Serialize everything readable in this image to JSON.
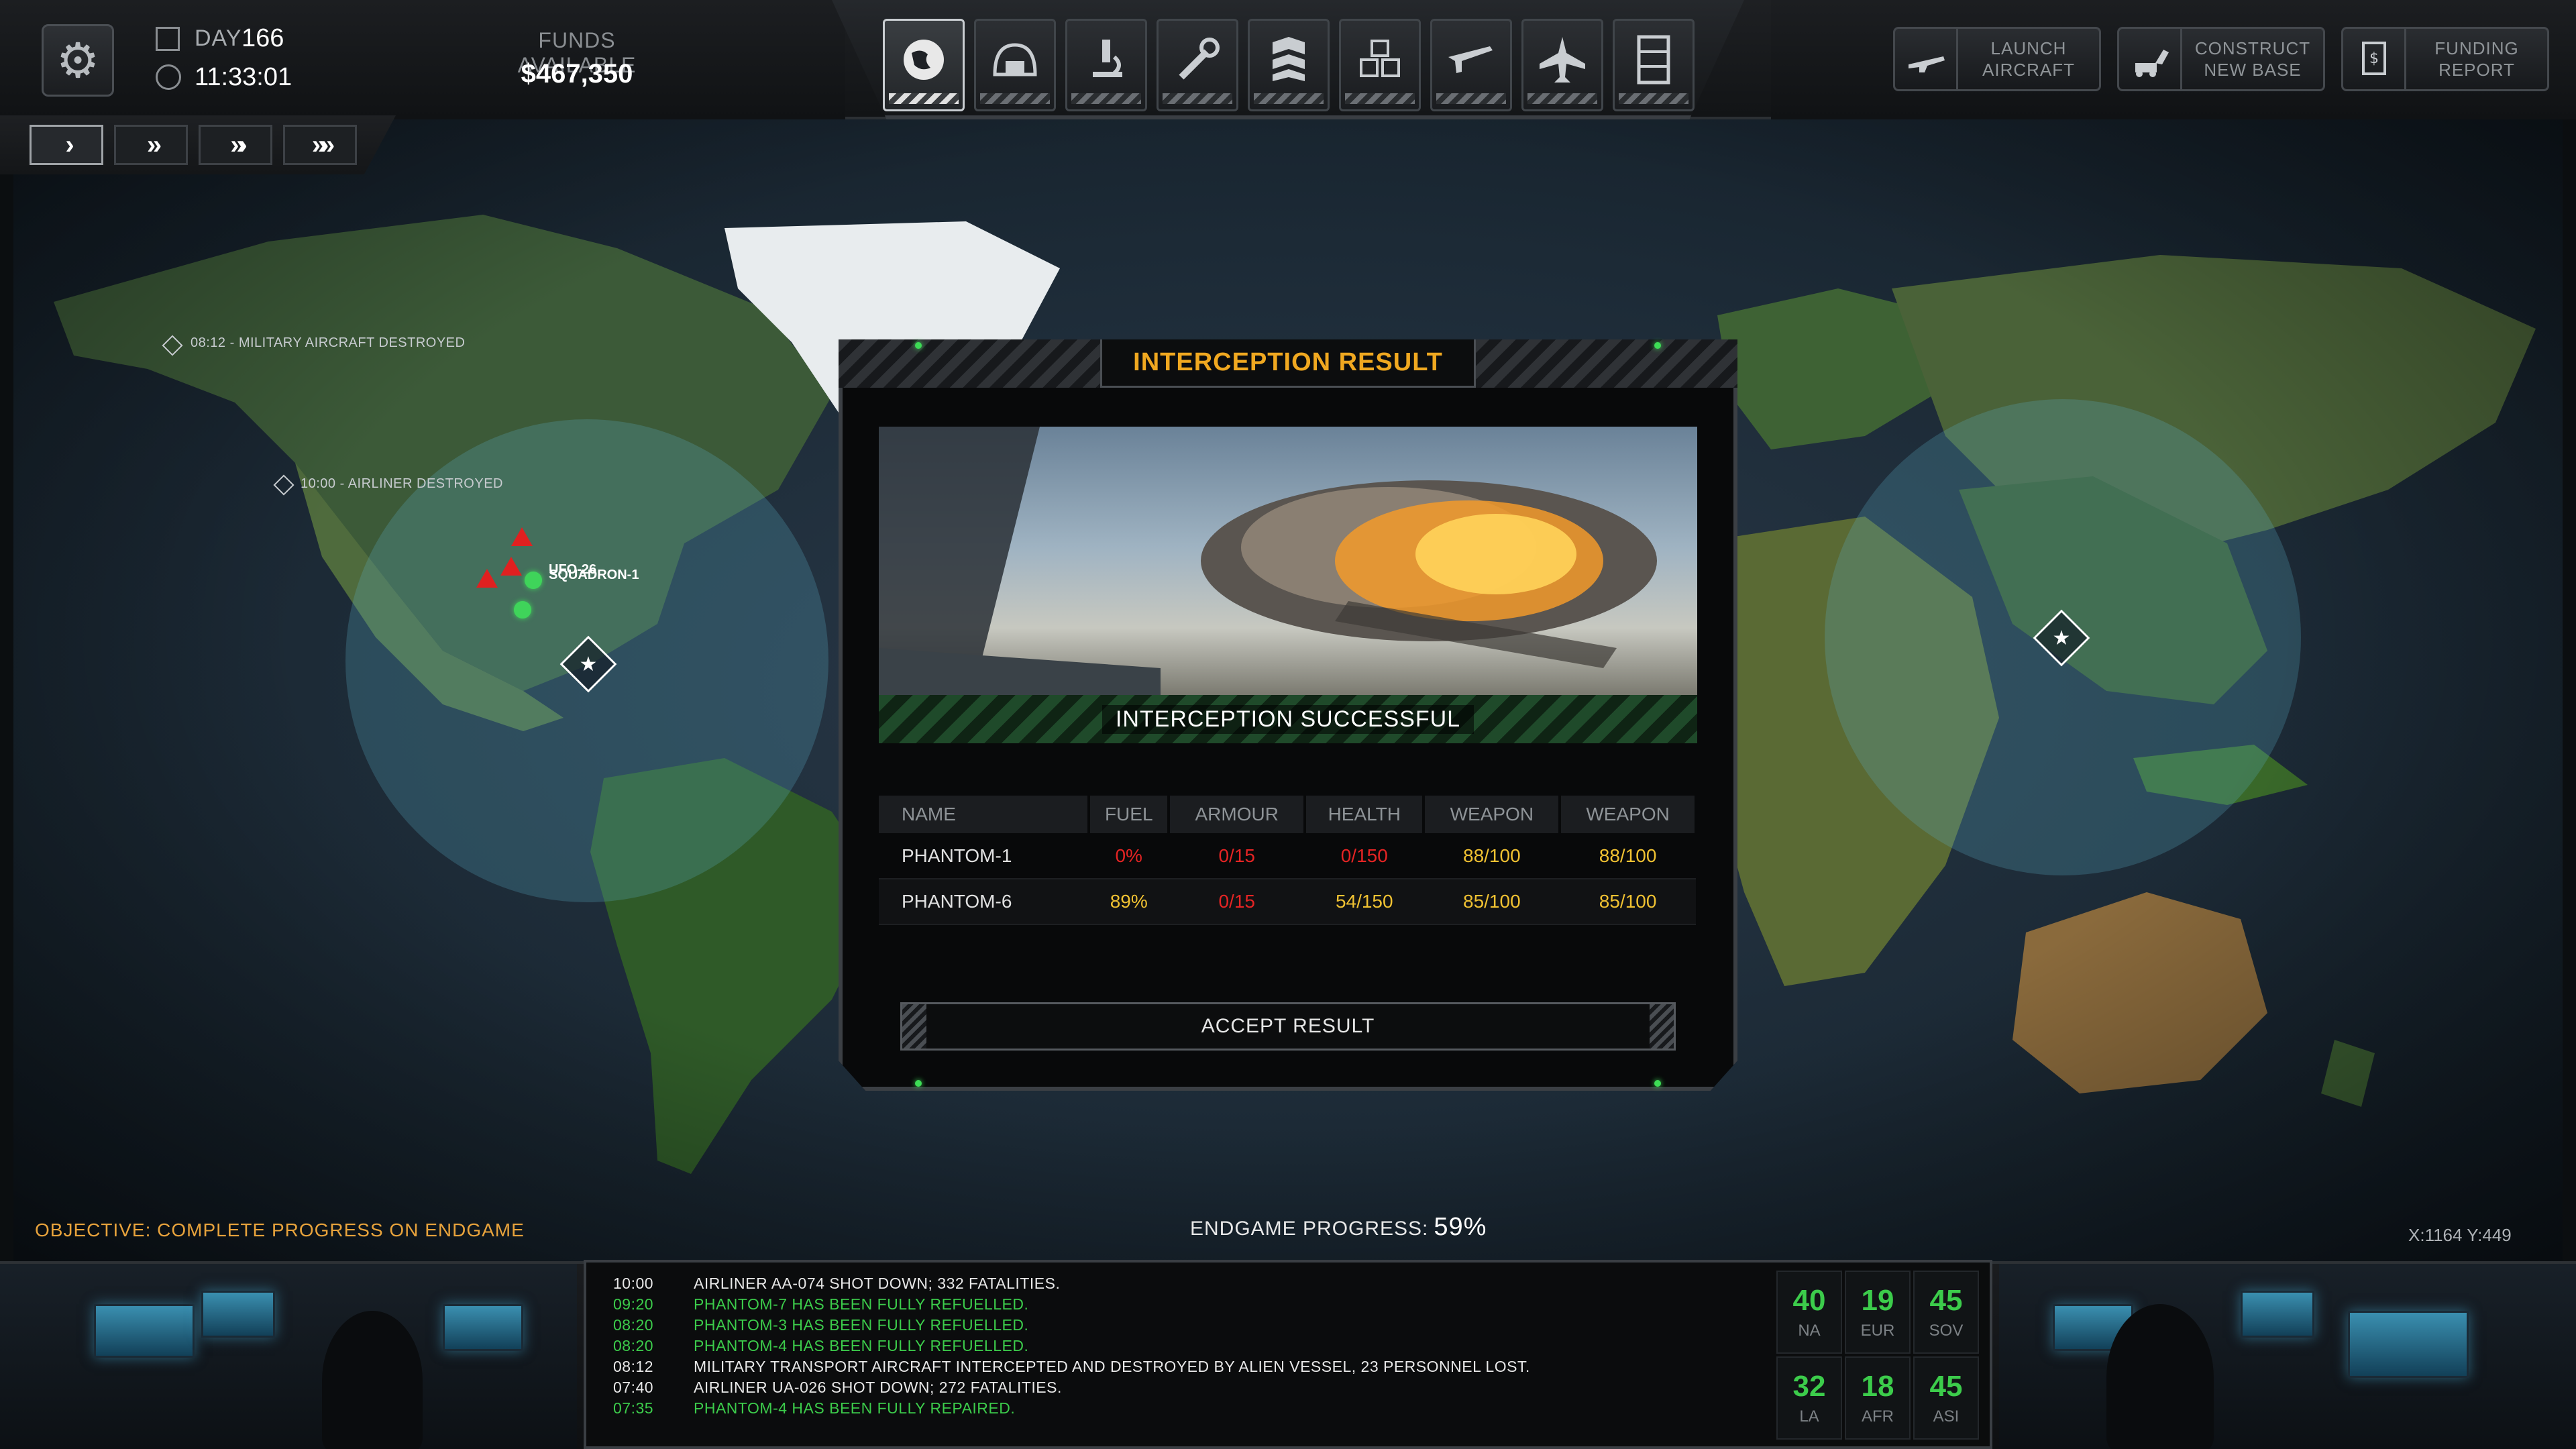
{
  "header": {
    "day_label": "DAY",
    "day_value": "166",
    "time": "11:33:01",
    "funds_label": "FUNDS AVAILABLE",
    "funds_value": "$467,350"
  },
  "nav": [
    {
      "name": "geoscape",
      "icon": "globe-icon",
      "active": true
    },
    {
      "name": "base",
      "icon": "hangar-dome-icon",
      "active": false
    },
    {
      "name": "research",
      "icon": "microscope-icon",
      "active": false
    },
    {
      "name": "engineering",
      "icon": "wrench-icon",
      "active": false
    },
    {
      "name": "soldiers",
      "icon": "rank-chevron-icon",
      "active": false
    },
    {
      "name": "stores",
      "icon": "crates-icon",
      "active": false
    },
    {
      "name": "armory",
      "icon": "rifle-icon",
      "active": false
    },
    {
      "name": "hangar",
      "icon": "jet-icon",
      "active": false
    },
    {
      "name": "archive",
      "icon": "cabinet-icon",
      "active": false
    }
  ],
  "actions": [
    {
      "id": "launch",
      "label": "LAUNCH\nAIRCRAFT",
      "icon": "aircraft-icon"
    },
    {
      "id": "construct",
      "label": "CONSTRUCT\nNEW BASE",
      "icon": "excavator-icon"
    },
    {
      "id": "funding",
      "label": "FUNDING\nREPORT",
      "icon": "report-icon"
    }
  ],
  "speed": {
    "active_index": 0
  },
  "map": {
    "event_labels": [
      "08:12 - MILITARY AIRCRAFT DESTROYED",
      "10:00 - AIRLINER DESTROYED"
    ],
    "ufo_label": "UFO-26",
    "squadron_label": "SQUADRON-1"
  },
  "dialog": {
    "title": "INTERCEPTION RESULT",
    "status": "INTERCEPTION SUCCESSFUL",
    "columns": [
      "NAME",
      "FUEL",
      "ARMOUR",
      "HEALTH",
      "WEAPON",
      "WEAPON"
    ],
    "rows": [
      {
        "name": "PHANTOM-1",
        "fuel": "0%",
        "armour": "0/15",
        "health": "0/150",
        "weapon1": "88/100",
        "weapon2": "88/100",
        "colors": {
          "fuel": "#e52424",
          "armour": "#e52424",
          "health": "#e52424",
          "weapon1": "#f1c232",
          "weapon2": "#f1c232"
        }
      },
      {
        "name": "PHANTOM-6",
        "fuel": "89%",
        "armour": "0/15",
        "health": "54/150",
        "weapon1": "85/100",
        "weapon2": "85/100",
        "colors": {
          "fuel": "#f1c232",
          "armour": "#e52424",
          "health": "#f1c232",
          "weapon1": "#f1c232",
          "weapon2": "#f1c232"
        }
      }
    ],
    "accept_label": "ACCEPT RESULT"
  },
  "objective": "OBJECTIVE: COMPLETE PROGRESS ON ENDGAME",
  "endgame": {
    "label": "ENDGAME PROGRESS:",
    "value": "59%"
  },
  "coords": "X:1164  Y:449",
  "log": [
    {
      "time": "10:00",
      "text": "AIRLINER AA-074 SHOT DOWN; 332 FATALITIES.",
      "color": "white"
    },
    {
      "time": "09:20",
      "text": "PHANTOM-7 HAS BEEN FULLY REFUELLED.",
      "color": "green"
    },
    {
      "time": "08:20",
      "text": "PHANTOM-3 HAS BEEN FULLY REFUELLED.",
      "color": "green"
    },
    {
      "time": "08:20",
      "text": "PHANTOM-4 HAS BEEN FULLY REFUELLED.",
      "color": "green"
    },
    {
      "time": "08:12",
      "text": "MILITARY TRANSPORT AIRCRAFT INTERCEPTED AND DESTROYED BY ALIEN VESSEL, 23 PERSONNEL LOST.",
      "color": "white"
    },
    {
      "time": "07:40",
      "text": "AIRLINER UA-026 SHOT DOWN; 272 FATALITIES.",
      "color": "white"
    },
    {
      "time": "07:35",
      "text": "PHANTOM-4 HAS BEEN FULLY REPAIRED.",
      "color": "green"
    }
  ],
  "regions": [
    {
      "code": "NA",
      "value": "40"
    },
    {
      "code": "EUR",
      "value": "19"
    },
    {
      "code": "SOV",
      "value": "45"
    },
    {
      "code": "LA",
      "value": "32"
    },
    {
      "code": "AFR",
      "value": "18"
    },
    {
      "code": "ASI",
      "value": "45"
    }
  ],
  "colors": {
    "accent": "#f0a820",
    "success": "#3ccc4b",
    "danger": "#e52424",
    "warning": "#f1c232"
  }
}
